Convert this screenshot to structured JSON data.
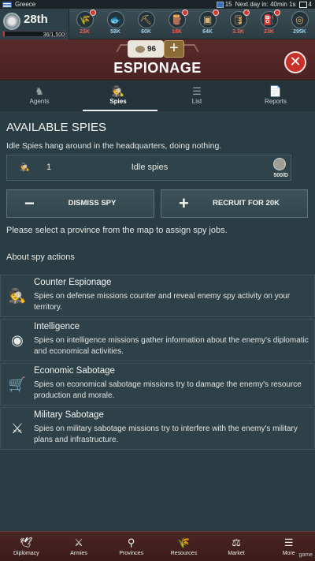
{
  "status_bar": {
    "country": "Greece",
    "day_badge": "15",
    "next_day": "Next day in: 40min 1s",
    "messages": "4"
  },
  "rank": {
    "label": "28th",
    "progress_text": "36/1,500",
    "progress_fraction": 0.024
  },
  "resources": [
    {
      "name": "Grain",
      "icon": "wheat-icon",
      "glyph": "🌾",
      "value": "23K",
      "color": "red",
      "alert": true
    },
    {
      "name": "Fish",
      "icon": "fish-icon",
      "glyph": "🐟",
      "value": "58K",
      "color": "blue",
      "alert": false
    },
    {
      "name": "Iron",
      "icon": "iron-icon",
      "glyph": "⛏",
      "value": "60K",
      "color": "white",
      "alert": false
    },
    {
      "name": "Wood",
      "icon": "wood-icon",
      "glyph": "🪵",
      "value": "18K",
      "color": "red",
      "alert": true
    },
    {
      "name": "Coal",
      "icon": "coal-icon",
      "glyph": "▣",
      "value": "64K",
      "color": "white",
      "alert": true
    },
    {
      "name": "Oil",
      "icon": "oil-barrel-icon",
      "glyph": "🛢",
      "value": "3.3K",
      "color": "red",
      "alert": true
    },
    {
      "name": "Gas",
      "icon": "gas-icon",
      "glyph": "⛽",
      "value": "23K",
      "color": "red",
      "alert": true
    },
    {
      "name": "Money",
      "icon": "money-icon",
      "glyph": "◎",
      "value": "295K",
      "color": "white",
      "alert": false
    }
  ],
  "header": {
    "gold": "96",
    "plus": "+",
    "title": "ESPIONAGE",
    "close": "✕"
  },
  "tabs": [
    {
      "label": "Agents",
      "icon": "agents-icon",
      "glyph": "♞",
      "active": false
    },
    {
      "label": "Spies",
      "icon": "spy-icon",
      "glyph": "🕵",
      "active": true
    },
    {
      "label": "List",
      "icon": "list-icon",
      "glyph": "☰",
      "active": false
    },
    {
      "label": "Reports",
      "icon": "report-icon",
      "glyph": "📄",
      "active": false
    }
  ],
  "spies": {
    "section_title": "AVAILABLE SPIES",
    "description": "Idle Spies hang around in the headquarters, doing nothing.",
    "idle_count": "1",
    "idle_label": "Idle spies",
    "upkeep": "500/D",
    "dismiss_label": "DISMISS SPY",
    "recruit_label": "RECRUIT FOR 20K",
    "hint": "Please select a province from the map to assign spy jobs.",
    "about": "About spy actions"
  },
  "actions": [
    {
      "title": "Counter Espionage",
      "icon": "counter-espionage-icon",
      "glyph": "🕵",
      "desc": "Spies on defense missions counter and reveal enemy spy activity on your territory."
    },
    {
      "title": "Intelligence",
      "icon": "intelligence-eye-icon",
      "glyph": "◉",
      "desc": "Spies on intelligence missions gather information about the enemy's diplomatic and economical activities."
    },
    {
      "title": "Economic Sabotage",
      "icon": "economic-sabotage-icon",
      "glyph": "🛒",
      "desc": "Spies on economical sabotage missions try to damage the enemy's resource production and morale."
    },
    {
      "title": "Military Sabotage",
      "icon": "military-sabotage-icon",
      "glyph": "⚔",
      "desc": "Spies on military sabotage missions try to interfere with the enemy's military plans and infrastructure."
    }
  ],
  "nav": [
    {
      "label": "Diplomacy",
      "icon": "diplomacy-dove-icon",
      "glyph": "🕊"
    },
    {
      "label": "Armies",
      "icon": "armies-icon",
      "glyph": "⚔"
    },
    {
      "label": "Provinces",
      "icon": "provinces-icon",
      "glyph": "⚲"
    },
    {
      "label": "Resources",
      "icon": "resources-icon",
      "glyph": "🌾"
    },
    {
      "label": "Market",
      "icon": "market-scale-icon",
      "glyph": "⚖"
    },
    {
      "label": "More",
      "icon": "menu-icon",
      "glyph": "☰"
    }
  ],
  "watermark": "game"
}
